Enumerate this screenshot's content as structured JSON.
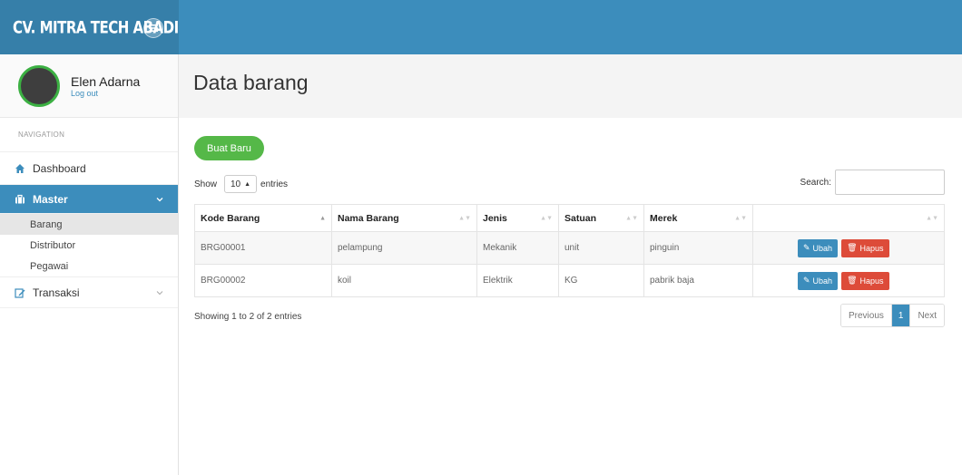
{
  "brand": {
    "title": "CV. MITRA TECH ABADI"
  },
  "user": {
    "name": "Elen Adarna",
    "logout": "Log out"
  },
  "nav": {
    "header": "NAVIGATION",
    "dashboard": "Dashboard",
    "master": "Master",
    "sub_items": [
      "Barang",
      "Distributor",
      "Pegawai"
    ],
    "transaksi": "Transaksi"
  },
  "page": {
    "title": "Data barang"
  },
  "toolbar": {
    "create_label": "Buat Baru",
    "show_label": "Show",
    "entries_value": "10",
    "entries_label": "entries",
    "search_label": "Search:"
  },
  "table": {
    "headers": [
      "Kode Barang",
      "Nama Barang",
      "Jenis",
      "Satuan",
      "Merek",
      ""
    ],
    "rows": [
      [
        "BRG00001",
        "pelampung",
        "Mekanik",
        "unit",
        "pinguin"
      ],
      [
        "BRG00002",
        "koil",
        "Elektrik",
        "KG",
        "pabrik baja"
      ]
    ],
    "edit_label": "Ubah",
    "delete_label": "Hapus"
  },
  "footer": {
    "info": "Showing 1 to 2 of 2 entries",
    "previous": "Previous",
    "current_page": "1",
    "next": "Next"
  },
  "colors": {
    "primary": "#3c8dbc",
    "success": "#55b848",
    "danger": "#dd4b39"
  }
}
